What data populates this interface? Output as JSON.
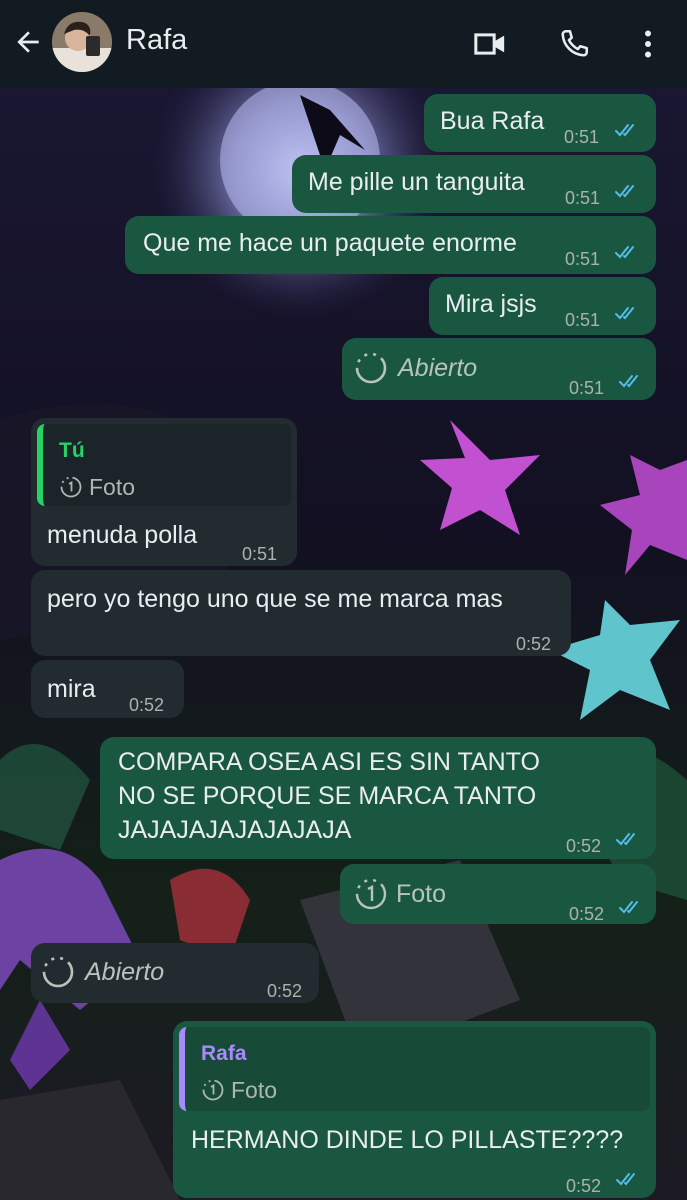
{
  "header": {
    "contact_name": "Rafa",
    "icons": [
      "back-arrow-icon",
      "video-call-icon",
      "phone-call-icon",
      "more-options-icon"
    ]
  },
  "colors": {
    "header_bg": "#111b21",
    "outgoing_bubble": "#1a5741",
    "incoming_bubble": "#222c30",
    "read_ticks": "#53bdeb",
    "quote_you_accent": "#25d366",
    "quote_rafa_accent": "#a78bfa"
  },
  "messages": [
    {
      "direction": "out",
      "text": "Bua Rafa",
      "time": "0:51",
      "status": "read"
    },
    {
      "direction": "out",
      "text": "Me pille un tanguita",
      "time": "0:51",
      "status": "read"
    },
    {
      "direction": "out",
      "text": "Que me hace un paquete enorme",
      "time": "0:51",
      "status": "read"
    },
    {
      "direction": "out",
      "text": "Mira jsjs",
      "time": "0:51",
      "status": "read"
    },
    {
      "direction": "out",
      "view_once": "Abierto",
      "time": "0:51",
      "status": "read"
    },
    {
      "direction": "in",
      "quote": {
        "author": "Tú",
        "text": "Foto"
      },
      "text": "menuda polla",
      "time": "0:51"
    },
    {
      "direction": "in",
      "text": "pero yo tengo uno que se me marca mas",
      "time": "0:52"
    },
    {
      "direction": "in",
      "text": "mira",
      "time": "0:52"
    },
    {
      "direction": "out",
      "text": "COMPARA OSEA ASI ES SIN TANTO\nNO SE PORQUE SE MARCA TANTO\nJAJAJAJAJAJAJAJA",
      "time": "0:52",
      "status": "read"
    },
    {
      "direction": "out",
      "view_once": "Foto",
      "time": "0:52",
      "status": "read"
    },
    {
      "direction": "in",
      "view_once": "Abierto",
      "time": "0:52"
    },
    {
      "direction": "out",
      "quote": {
        "author": "Rafa",
        "text": "Foto"
      },
      "text": "HERMANO DINDE LO PILLASTE????",
      "time": "0:52",
      "status": "read"
    }
  ]
}
